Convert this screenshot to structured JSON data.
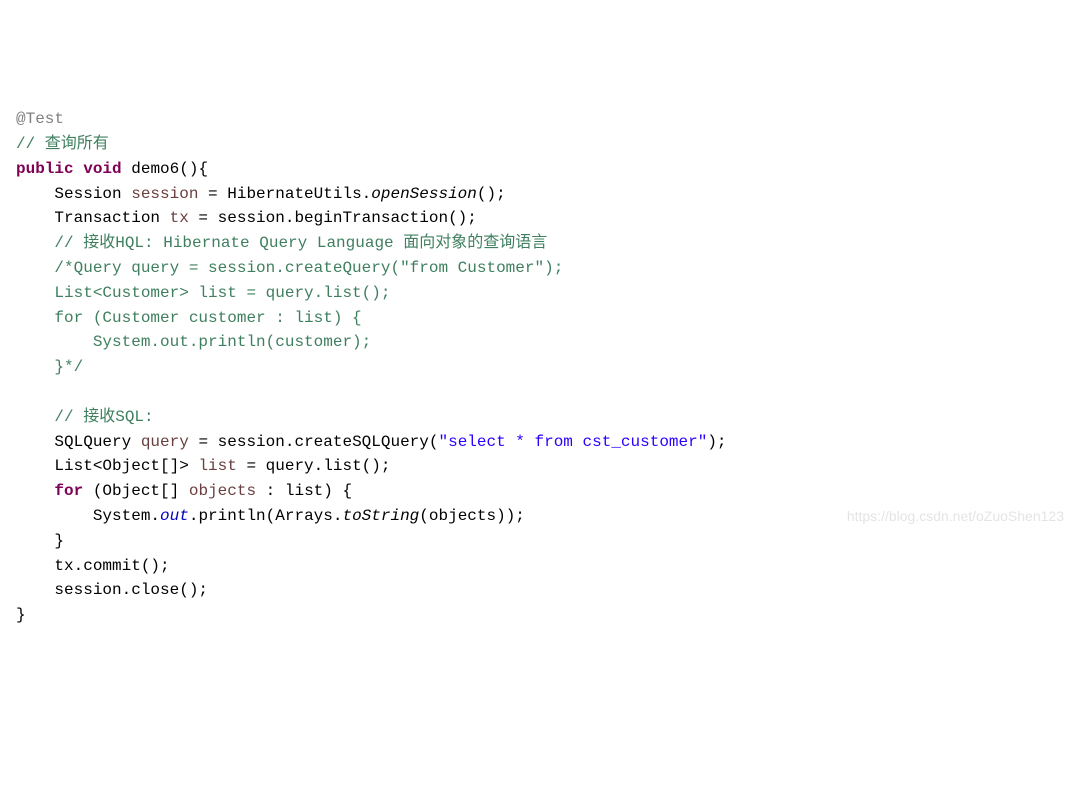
{
  "code": {
    "line1_annotation": "@Test",
    "line2_comment": "// 查询所有",
    "line3_public": "public",
    "line3_void": "void",
    "line3_method": "demo6",
    "line3_paren": "(){",
    "line4_indent": "    ",
    "line4_type": "Session ",
    "line4_var": "session",
    "line4_eq": " = HibernateUtils.",
    "line4_call": "openSession",
    "line4_end": "();",
    "line5_indent": "    ",
    "line5_text": "Transaction ",
    "line5_var": "tx",
    "line5_rest": " = session.beginTransaction();",
    "line6_indent": "    ",
    "line6_comment": "// 接收HQL: Hibernate Query Language 面向对象的查询语言",
    "line7_indent": "    ",
    "line7_comment": "/*Query query = session.createQuery(\"from Customer\");",
    "line8_indent": "    ",
    "line8_comment": "List<Customer> list = query.list();",
    "line9_indent": "    ",
    "line9_comment": "for (Customer customer : list) {",
    "line10_indent": "        ",
    "line10_comment": "System.out.println(customer);",
    "line11_indent": "    ",
    "line11_comment": "}*/",
    "line13_indent": "    ",
    "line13_comment": "// 接收SQL:",
    "line14_indent": "    ",
    "line14_type": "SQLQuery ",
    "line14_var": "query",
    "line14_mid": " = session.createSQLQuery(",
    "line14_str": "\"select * from cst_customer\"",
    "line14_end": ");",
    "line15_indent": "    ",
    "line15_type": "List<Object[]> ",
    "line15_var": "list",
    "line15_mid": " = query.list();",
    "line16_indent": "    ",
    "line16_for": "for",
    "line16_mid": " (Object[] ",
    "line16_var": "objects",
    "line16_rest": " : list) {",
    "line17_indent": "        ",
    "line17_sys": "System.",
    "line17_out": "out",
    "line17_print": ".println(Arrays.",
    "line17_tostr": "toString",
    "line17_end": "(objects));",
    "line18_indent": "    ",
    "line18_brace": "}",
    "line19_indent": "    ",
    "line19_text": "tx.commit();",
    "line20_indent": "    ",
    "line20_text": "session.close();",
    "line21_brace": "}"
  },
  "watermark": "https://blog.csdn.net/oZuoShen123"
}
